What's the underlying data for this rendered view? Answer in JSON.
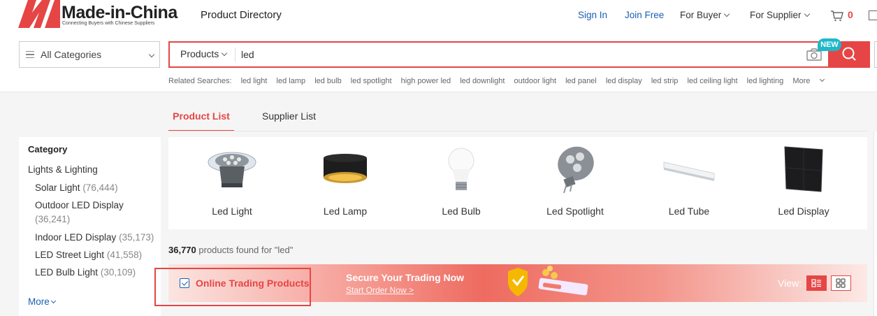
{
  "header": {
    "logo_text": "Made-in-China",
    "logo_tagline": "Connecting Buyers with Chinese Suppliers",
    "product_directory": "Product Directory",
    "sign_in": "Sign In",
    "join_free": "Join Free",
    "for_buyer": "For Buyer",
    "for_supplier": "For Supplier",
    "cart_count": "0"
  },
  "search": {
    "all_categories": "All Categories",
    "type_selector": "Products",
    "query": "led",
    "new_badge": "NEW",
    "related_label": "Related Searches:",
    "related": [
      "led light",
      "led lamp",
      "led bulb",
      "led spotlight",
      "high power led",
      "led downlight",
      "outdoor light",
      "led panel",
      "led display",
      "led strip",
      "led ceiling light",
      "led lighting"
    ],
    "more": "More"
  },
  "tabs": [
    "Product List",
    "Supplier List"
  ],
  "sidebar": {
    "title": "Category",
    "parent": "Lights & Lighting",
    "items": [
      {
        "name": "Solar Light",
        "count": "(76,444)"
      },
      {
        "name": "Outdoor LED Display",
        "count": "(36,241)"
      },
      {
        "name": "Indoor LED Display",
        "count": "(35,173)"
      },
      {
        "name": "LED Street Light",
        "count": "(41,558)"
      },
      {
        "name": "LED Bulb Light",
        "count": "(30,109)"
      }
    ],
    "more": "More"
  },
  "categories": [
    "Led Light",
    "Led Lamp",
    "Led Bulb",
    "Led Spotlight",
    "Led Tube",
    "Led Display"
  ],
  "results": {
    "count": "36,770",
    "text": "products found for \"led\""
  },
  "banner": {
    "online_trading": "Online Trading Products",
    "title": "Secure Your Trading Now",
    "link": "Start Order Now >",
    "view_label": "View:"
  },
  "colors": {
    "accent": "#e64545",
    "link": "#1a5fb4",
    "badge": "#1eb8c9"
  }
}
